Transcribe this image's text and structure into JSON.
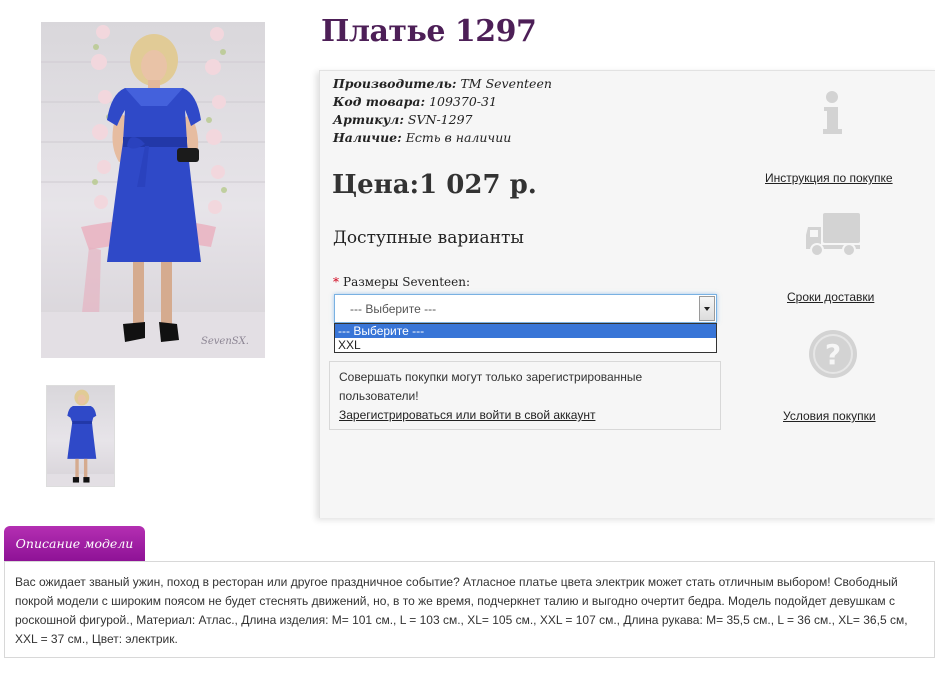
{
  "product": {
    "title": "Платье 1297",
    "main_image_alt": "Синее атласное платье",
    "thumbnail_alt": "Миниатюра платья"
  },
  "details": [
    {
      "label": "Производитель:",
      "value": "TM Seventeen"
    },
    {
      "label": "Код товара:",
      "value": "109370-31"
    },
    {
      "label": "Артикул:",
      "value": "SVN-1297"
    },
    {
      "label": "Наличие:",
      "value": "Есть в наличии"
    }
  ],
  "price": "Цена:1 027 р.",
  "variants": {
    "heading": "Доступные варианты",
    "required_mark": "*",
    "size_label": "Размеры Seventeen:",
    "selected": "--- Выберите ---",
    "options": [
      "--- Выберите ---",
      "XXL"
    ]
  },
  "login_notice": {
    "text": "Совершать покупки могут только зарегистрированные пользователи!",
    "link": "Зарегистрироваться или войти в свой аккаунт"
  },
  "sidebar": {
    "instructions": {
      "icon": "info-icon",
      "label": "Инструкция по покупке"
    },
    "delivery": {
      "icon": "truck-icon",
      "label": "Сроки доставки"
    },
    "terms": {
      "icon": "question-icon",
      "label": "Условия покупки"
    }
  },
  "description": {
    "tab": "Описание модели",
    "text": "Вас ожидает званый ужин, поход в ресторан или другое праздничное событие? Атласное платье цвета электрик может стать отличным выбором! Свободный покрой модели с широким поясом не будет стеснять движений, но, в то же время, подчеркнет талию и выгодно очертит бедра. Модель подойдет девушкам с роскошной фигурой., Материал: Атлас., Длина изделия: M= 101 см., L = 103 см., XL= 105 см., XXL = 107 см., Длина рукава: M= 35,5 см., L = 36 см., XL= 36,5 см, XXL = 37 см., Цвет: электрик."
  },
  "colors": {
    "title": "#4d1f57",
    "tab": "#a21fa6",
    "dress": "#2f49c8",
    "select_highlight": "#3875d7"
  }
}
